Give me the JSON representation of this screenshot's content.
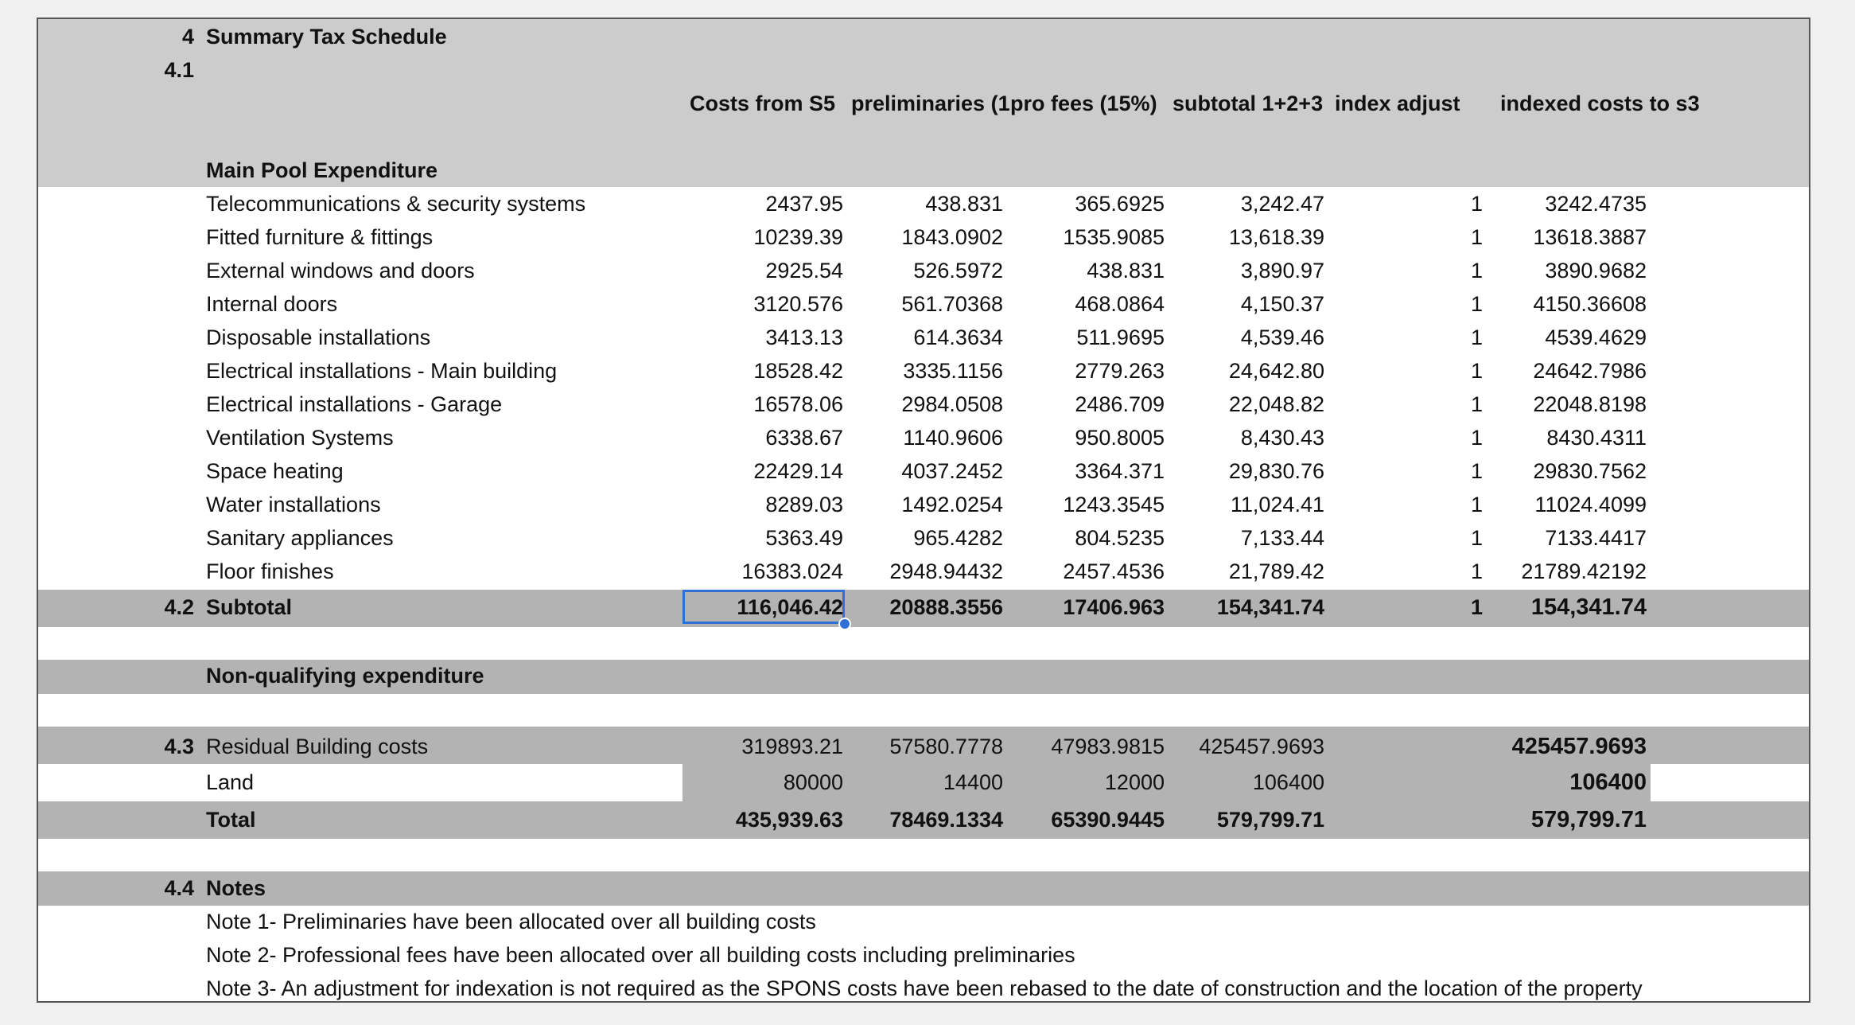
{
  "section_num": "4",
  "section_title": "Summary Tax Schedule",
  "sub_41": "4.1",
  "columns": [
    "Costs from S5",
    "preliminaries (1",
    "pro fees (15%)",
    "subtotal 1+2+3",
    "index adjust",
    "indexed costs to s3"
  ],
  "main_pool_title": "Main Pool Expenditure",
  "rows": [
    {
      "label": "Telecommunications & security systems",
      "values": [
        "2437.95",
        "438.831",
        "365.6925",
        "3,242.47",
        "1",
        "3242.4735"
      ]
    },
    {
      "label": "Fitted furniture & fittings",
      "values": [
        "10239.39",
        "1843.0902",
        "1535.9085",
        "13,618.39",
        "1",
        "13618.3887"
      ]
    },
    {
      "label": "External windows and doors",
      "values": [
        "2925.54",
        "526.5972",
        "438.831",
        "3,890.97",
        "1",
        "3890.9682"
      ]
    },
    {
      "label": "Internal doors",
      "values": [
        "3120.576",
        "561.70368",
        "468.0864",
        "4,150.37",
        "1",
        "4150.36608"
      ]
    },
    {
      "label": "Disposable installations",
      "values": [
        "3413.13",
        "614.3634",
        "511.9695",
        "4,539.46",
        "1",
        "4539.4629"
      ]
    },
    {
      "label": "Electrical installations - Main building",
      "values": [
        "18528.42",
        "3335.1156",
        "2779.263",
        "24,642.80",
        "1",
        "24642.7986"
      ]
    },
    {
      "label": "Electrical installations  - Garage",
      "values": [
        "16578.06",
        "2984.0508",
        "2486.709",
        "22,048.82",
        "1",
        "22048.8198"
      ]
    },
    {
      "label": "Ventilation Systems",
      "values": [
        "6338.67",
        "1140.9606",
        "950.8005",
        "8,430.43",
        "1",
        "8430.4311"
      ]
    },
    {
      "label": "Space heating",
      "values": [
        "22429.14",
        "4037.2452",
        "3364.371",
        "29,830.76",
        "1",
        "29830.7562"
      ]
    },
    {
      "label": "Water installations",
      "values": [
        "8289.03",
        "1492.0254",
        "1243.3545",
        "11,024.41",
        "1",
        "11024.4099"
      ]
    },
    {
      "label": "Sanitary appliances",
      "values": [
        "5363.49",
        "965.4282",
        "804.5235",
        "7,133.44",
        "1",
        "7133.4417"
      ]
    },
    {
      "label": "Floor finishes",
      "values": [
        "16383.024",
        "2948.94432",
        "2457.4536",
        "21,789.42",
        "1",
        "21789.42192"
      ]
    }
  ],
  "subtotal": {
    "num": "4.2",
    "label": "Subtotal",
    "values": [
      "116,046.42",
      "20888.3556",
      "17406.963",
      "154,341.74",
      "1",
      "154,341.74"
    ]
  },
  "nonqual_title": "Non-qualifying expenditure",
  "residual": {
    "num": "4.3",
    "label": "Residual Building costs",
    "values": [
      "319893.21",
      "57580.7778",
      "47983.9815",
      "425457.9693",
      "",
      "425457.9693"
    ]
  },
  "land": {
    "label": "Land",
    "values": [
      "80000",
      "14400",
      "12000",
      "106400",
      "",
      "106400"
    ]
  },
  "total": {
    "label": "Total",
    "values": [
      "435,939.63",
      "78469.1334",
      "65390.9445",
      "579,799.71",
      "",
      "579,799.71"
    ]
  },
  "notes_num": "4.4",
  "notes_title": "Notes",
  "notes": [
    "Note 1- Preliminaries have been allocated over all building costs",
    "Note 2- Professional fees have been allocated over all building costs including preliminaries",
    "Note 3- An adjustment for indexation is not required as the SPONS costs have been rebased to the date of construction and the location of the property"
  ],
  "colors": {
    "header_band": "#cccccc",
    "band": "#b3b3b3",
    "white": "#ffffff",
    "selection": "#2f6fd6"
  }
}
